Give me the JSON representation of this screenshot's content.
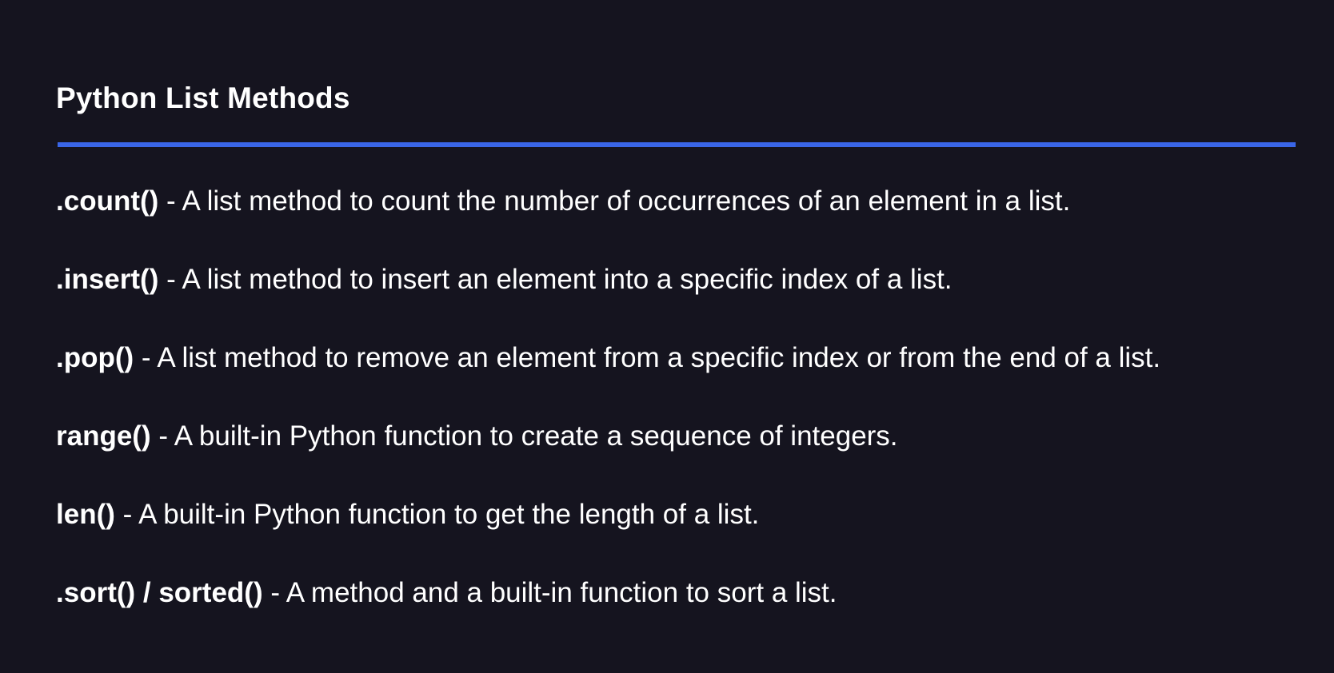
{
  "title": "Python List Methods",
  "colors": {
    "background": "#15141f",
    "accent_rule": "#3a66e8",
    "text": "#ffffff"
  },
  "items": [
    {
      "term": ".count()",
      "description": " - A list method to count the number of occurrences of an element in a list."
    },
    {
      "term": ".insert()",
      "description": " - A list method to insert an element into a specific index of a list."
    },
    {
      "term": ".pop()",
      "description": " - A list method to remove an element from a specific index or from the end of a list."
    },
    {
      "term": "range()",
      "description": " - A built-in Python function to create a sequence of integers."
    },
    {
      "term": "len()",
      "description": " - A built-in Python function to get the length of a list."
    },
    {
      "term": ".sort() / sorted()",
      "description": " - A method and a built-in function to sort a list."
    }
  ]
}
